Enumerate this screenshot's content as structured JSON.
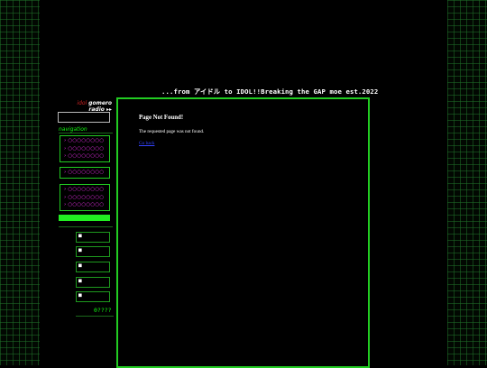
{
  "header": {
    "tagline": "...from アイドル to IDOL!!Breaking the GAP moe est.2022"
  },
  "logo": {
    "line1_a": "idol",
    "line1_b": "gomero",
    "line2": "radio ▸▸"
  },
  "sidebar": {
    "nav_heading": "navigation",
    "groups": [
      {
        "items": [
          "○○○○○○○○",
          "○○○○○○○○",
          "○○○○○○○○"
        ]
      },
      {
        "items": [
          "○○○○○○○○"
        ]
      },
      {
        "items": [
          "○○○○○○○○",
          "○○○○○○○○",
          "○○○○○○○○"
        ]
      }
    ],
    "mini_boxes": [
      "■",
      "■",
      "■",
      "■",
      "■"
    ],
    "counter": "0????"
  },
  "content": {
    "title": "Page Not Found!",
    "text": "The requested page was not found.",
    "link": "Go back"
  },
  "colors": {
    "background": "#000000",
    "accent_green": "#22cc22",
    "nav_pink": "#ff33ff",
    "grid_line": "#1e6e28"
  }
}
